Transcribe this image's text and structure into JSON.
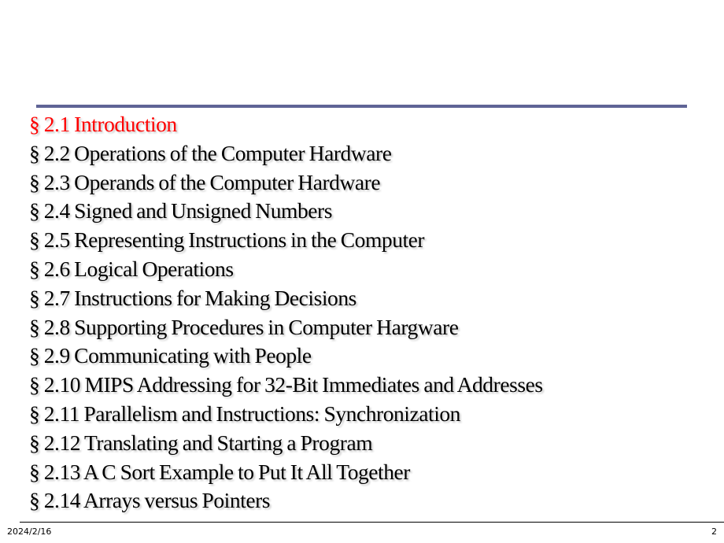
{
  "slide": {
    "accent_color": "#ff0000",
    "rule_color": "#5f6496",
    "toc": [
      {
        "label": "§ 2.1 Introduction",
        "active": true
      },
      {
        "label": "§ 2.2 Operations of the Computer Hardware",
        "active": false
      },
      {
        "label": "§ 2.3 Operands of the Computer Hardware",
        "active": false
      },
      {
        "label": "§ 2.4 Signed and Unsigned Numbers",
        "active": false
      },
      {
        "label": "§ 2.5 Representing Instructions in the Computer",
        "active": false
      },
      {
        "label": "§ 2.6 Logical Operations",
        "active": false
      },
      {
        "label": "§ 2.7 Instructions for Making Decisions",
        "active": false
      },
      {
        "label": "§ 2.8 Supporting Procedures in Computer Hargware",
        "active": false
      },
      {
        "label": "§ 2.9 Communicating with People",
        "active": false
      },
      {
        "label": "§ 2.10 MIPS Addressing for 32-Bit Immediates and Addresses",
        "active": false
      },
      {
        "label": "§ 2.11 Parallelism and Instructions:  Synchronization",
        "active": false
      },
      {
        "label": "§ 2.12 Translating and Starting a Program",
        "active": false
      },
      {
        "label": "§ 2.13 A C Sort Example to Put It All Together",
        "active": false
      },
      {
        "label": "§ 2.14 Arrays versus Pointers",
        "active": false
      }
    ]
  },
  "footer": {
    "date": "2024/2/16",
    "page_number": "2"
  }
}
